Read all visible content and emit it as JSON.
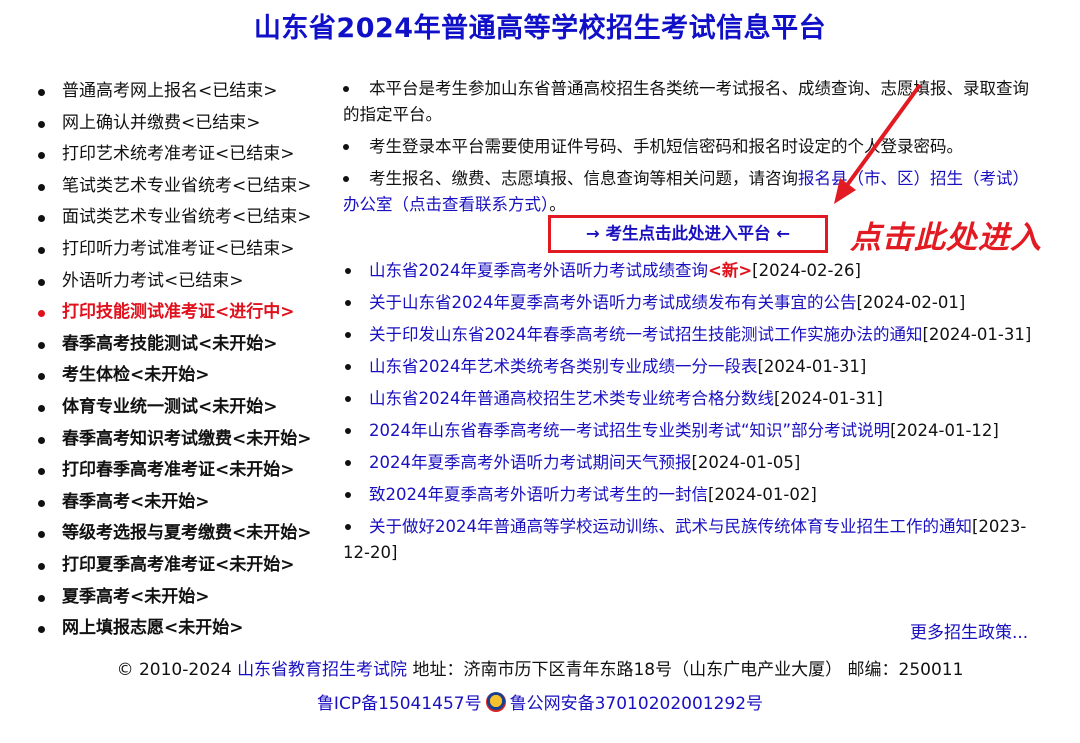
{
  "title": "山东省2024年普通高等学校招生考试信息平台",
  "left_menu": [
    {
      "label": "普通高考网上报名<已结束>",
      "state": "done"
    },
    {
      "label": "网上确认并缴费<已结束>",
      "state": "done"
    },
    {
      "label": "打印艺术统考准考证<已结束>",
      "state": "done"
    },
    {
      "label": "笔试类艺术专业省统考<已结束>",
      "state": "done"
    },
    {
      "label": "面试类艺术专业省统考<已结束>",
      "state": "done"
    },
    {
      "label": "打印听力考试准考证<已结束>",
      "state": "done"
    },
    {
      "label": "外语听力考试<已结束>",
      "state": "done"
    },
    {
      "label": "打印技能测试准考证<进行中>",
      "state": "active"
    },
    {
      "label": "春季高考技能测试<未开始>",
      "state": "pending"
    },
    {
      "label": "考生体检<未开始>",
      "state": "pending"
    },
    {
      "label": "体育专业统一测试<未开始>",
      "state": "pending"
    },
    {
      "label": "春季高考知识考试缴费<未开始>",
      "state": "pending"
    },
    {
      "label": "打印春季高考准考证<未开始>",
      "state": "pending"
    },
    {
      "label": "春季高考<未开始>",
      "state": "pending"
    },
    {
      "label": "等级考选报与夏考缴费<未开始>",
      "state": "pending"
    },
    {
      "label": "打印夏季高考准考证<未开始>",
      "state": "pending"
    },
    {
      "label": "夏季高考<未开始>",
      "state": "pending"
    },
    {
      "label": "网上填报志愿<未开始>",
      "state": "pending"
    }
  ],
  "notices": {
    "n1": "本平台是考生参加山东省普通高校招生各类统一考试报名、成绩查询、志愿填报、录取查询的指定平台。",
    "n2": "考生登录本平台需要使用证件号码、手机短信密码和报名时设定的个人登录密码。",
    "n3_prefix": "考生报名、缴费、志愿填报、信息查询等相关问题，请咨询",
    "n3_link": "报名县（市、区）招生（考试）办公室（点击查看联系方式）",
    "n3_suffix": "。"
  },
  "enter_button": "→ 考生点击此处进入平台 ←",
  "callout": "点击此处进入",
  "news": [
    {
      "title": "山东省2024年夏季高考外语听力考试成绩查询",
      "tag": "<新>",
      "date": "[2024-02-26]"
    },
    {
      "title": "关于山东省2024年夏季高考外语听力考试成绩发布有关事宜的公告",
      "tag": "",
      "date": "[2024-02-01]"
    },
    {
      "title": "关于印发山东省2024年春季高考统一考试招生技能测试工作实施办法的通知",
      "tag": "",
      "date": "[2024-01-31]"
    },
    {
      "title": "山东省2024年艺术类统考各类别专业成绩一分一段表",
      "tag": "",
      "date": "[2024-01-31]"
    },
    {
      "title": "山东省2024年普通高校招生艺术类专业统考合格分数线",
      "tag": "",
      "date": "[2024-01-31]"
    },
    {
      "title": "2024年山东省春季高考统一考试招生专业类别考试“知识”部分考试说明",
      "tag": "",
      "date": "[2024-01-12]"
    },
    {
      "title": "2024年夏季高考外语听力考试期间天气预报",
      "tag": "",
      "date": "[2024-01-05]"
    },
    {
      "title": "致2024年夏季高考外语听力考试考生的一封信",
      "tag": "",
      "date": "[2024-01-02]"
    },
    {
      "title": "关于做好2024年普通高等学校运动训练、武术与民族传统体育专业招生工作的通知",
      "tag": "",
      "date": "[2023-12-20]"
    }
  ],
  "more_link": "更多招生政策...",
  "footer": {
    "copyright": "© 2010-2024 ",
    "org_link": "山东省教育招生考试院",
    "address": " 地址：济南市历下区青年东路18号（山东广电产业大厦） 邮编：250011",
    "icp": "鲁ICP备15041457号",
    "police": "鲁公网安备37010202001292号"
  },
  "colors": {
    "title": "#1010c8",
    "link": "#1a10c0",
    "accent_red": "#e21a22"
  }
}
